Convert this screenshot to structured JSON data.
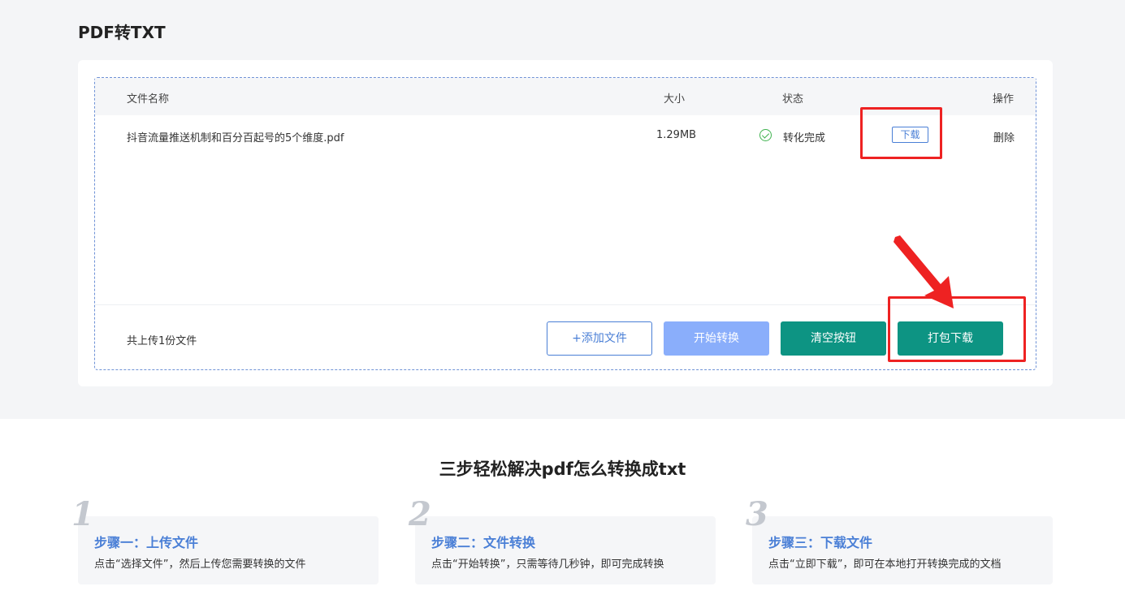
{
  "page": {
    "title": "PDF转TXT"
  },
  "table": {
    "headers": {
      "name": "文件名称",
      "size": "大小",
      "status": "状态",
      "action": "操作"
    },
    "rows": [
      {
        "name": "抖音流量推送机制和百分百起号的5个维度.pdf",
        "size": "1.29MB",
        "status": "转化完成",
        "download_label": "下载",
        "delete_label": "删除"
      }
    ]
  },
  "footer": {
    "count_text": "共上传1份文件",
    "add_label": "+添加文件",
    "start_label": "开始转换",
    "clear_label": "清空按钮",
    "pack_label": "打包下载"
  },
  "steps_section": {
    "title": "三步轻松解决pdf怎么转换成txt",
    "steps": [
      {
        "number": "1",
        "title": "步骤一：上传文件",
        "desc": "点击“选择文件”，然后上传您需要转换的文件"
      },
      {
        "number": "2",
        "title": "步骤二：文件转换",
        "desc": "点击“开始转换”，只需等待几秒钟，即可完成转换"
      },
      {
        "number": "3",
        "title": "步骤三：下载文件",
        "desc": "点击“立即下载”，即可在本地打开转换完成的文档"
      }
    ]
  },
  "colors": {
    "accent_blue": "#4a7fd6",
    "teal": "#0d9483",
    "disabled_blue": "#8aaefb",
    "annotation_red": "#ee2222",
    "success_green": "#3fb24f"
  }
}
